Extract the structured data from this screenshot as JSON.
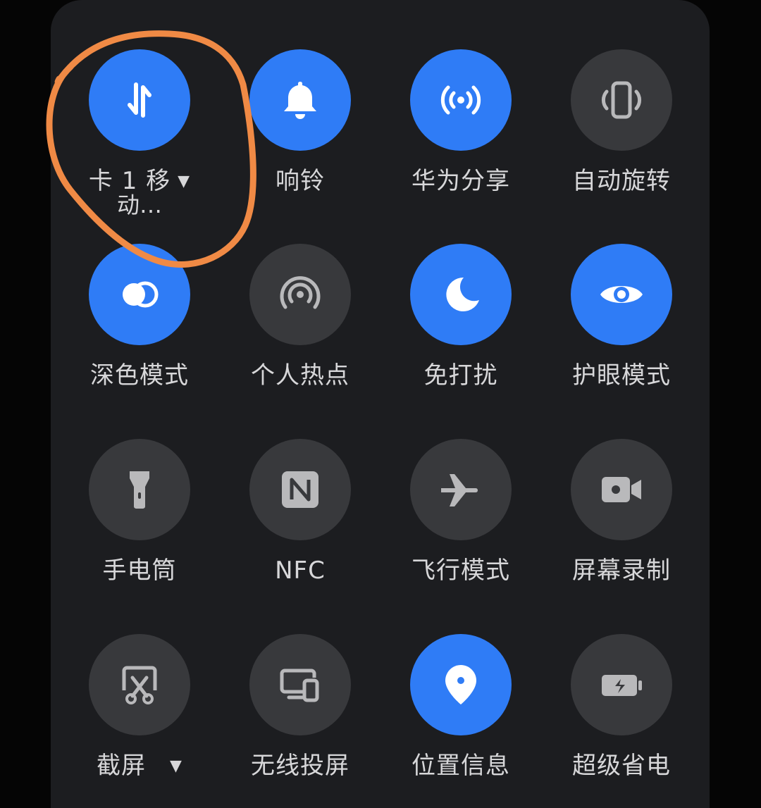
{
  "colors": {
    "accent": "#2f7cf6",
    "tile_off": "#38393c",
    "panel": "#1c1d20",
    "annotation": "#f08a45"
  },
  "tiles": [
    {
      "label": "卡 1 移",
      "label2": "动…",
      "dropdown": "▼",
      "icon": "mobile-data-icon",
      "on": true
    },
    {
      "label": "响铃",
      "icon": "bell-icon",
      "on": true
    },
    {
      "label": "华为分享",
      "icon": "huawei-share-icon",
      "on": true
    },
    {
      "label": "自动旋转",
      "icon": "auto-rotate-icon",
      "on": false
    },
    {
      "label": "深色模式",
      "icon": "dark-mode-icon",
      "on": true
    },
    {
      "label": "个人热点",
      "icon": "hotspot-icon",
      "on": false
    },
    {
      "label": "免打扰",
      "icon": "moon-icon",
      "on": true
    },
    {
      "label": "护眼模式",
      "icon": "eye-icon",
      "on": true
    },
    {
      "label": "手电筒",
      "icon": "flashlight-icon",
      "on": false
    },
    {
      "label": "NFC",
      "icon": "nfc-icon",
      "on": false
    },
    {
      "label": "飞行模式",
      "icon": "airplane-icon",
      "on": false
    },
    {
      "label": "屏幕录制",
      "icon": "screen-record-icon",
      "on": false
    },
    {
      "label": "截屏",
      "dropdown": "▼",
      "icon": "screenshot-icon",
      "on": false
    },
    {
      "label": "无线投屏",
      "icon": "wireless-projection-icon",
      "on": false
    },
    {
      "label": "位置信息",
      "icon": "location-icon",
      "on": true
    },
    {
      "label": "超级省电",
      "icon": "battery-saver-icon",
      "on": false
    }
  ]
}
